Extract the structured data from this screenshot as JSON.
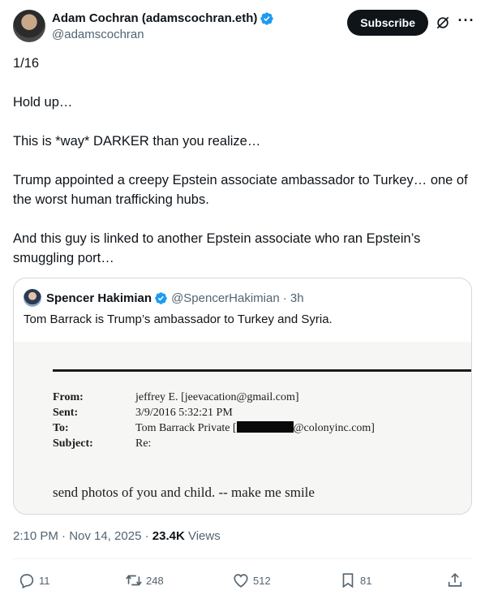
{
  "author": {
    "display_name": "Adam Cochran (adamscochran.eth)",
    "handle": "@adamscochran"
  },
  "header": {
    "subscribe_label": "Subscribe",
    "more_label": "···"
  },
  "tweet": {
    "paragraphs": [
      "1/16",
      "Hold up…",
      "This is *way* DARKER than you realize…",
      "Trump appointed a creepy Epstein associate ambassador to Turkey… one of the worst human trafficking hubs.",
      "And this guy is linked to another Epstein associate who ran Epstein’s smuggling port…"
    ]
  },
  "quote": {
    "name": "Spencer Hakimian",
    "handle": "@SpencerHakimian",
    "time": "· 3h",
    "text": "Tom Barrack is Trump’s ambassador to Turkey and Syria.",
    "email": {
      "from_label": "From:",
      "from_value": "jeffrey E. [jeevacation@gmail.com]",
      "sent_label": "Sent:",
      "sent_value": "3/9/2016 5:32:21 PM",
      "to_label": "To:",
      "to_value_prefix": "Tom Barrack Private [",
      "to_value_suffix": "@colonyinc.com]",
      "subject_label": "Subject:",
      "subject_value": "Re:",
      "body": "send photos of you and child.   -- make me smile"
    }
  },
  "meta": {
    "time": "2:10 PM · Nov 14, 2025 · ",
    "views_count": "23.4K",
    "views_label": " Views"
  },
  "actions": {
    "replies": "11",
    "reposts": "248",
    "likes": "512",
    "bookmarks": "81"
  },
  "colors": {
    "verified": "#1d9bf0",
    "text": "#0f1419",
    "muted": "#536471"
  }
}
